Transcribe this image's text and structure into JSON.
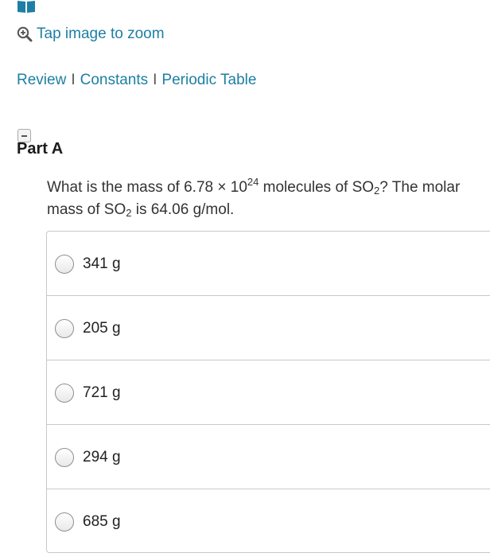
{
  "icons": {
    "book": "book-icon",
    "zoom": "zoom-in-icon",
    "collapse": "collapse-minus-icon"
  },
  "colors": {
    "link": "#1d7fa3",
    "book_icon": "#1d7fa3",
    "border": "#c8c8c8"
  },
  "zoom": {
    "label": "Tap image to zoom"
  },
  "links": {
    "review": "Review",
    "constants": "Constants",
    "periodic_table": "Periodic Table",
    "separator": "I"
  },
  "part": {
    "title": "Part A"
  },
  "question": {
    "q_prefix": "What is the mass of 6.78 × 10",
    "q_exponent": "24",
    "q_middle": " molecules of SO",
    "q_sub1": "2",
    "q_after": "? The molar mass of SO",
    "q_sub2": "2",
    "q_end": " is 64.06 g/mol."
  },
  "options": [
    {
      "label": "341 g",
      "selected": false
    },
    {
      "label": "205 g",
      "selected": false
    },
    {
      "label": "721 g",
      "selected": false
    },
    {
      "label": "294 g",
      "selected": false
    },
    {
      "label": "685 g",
      "selected": false
    }
  ]
}
